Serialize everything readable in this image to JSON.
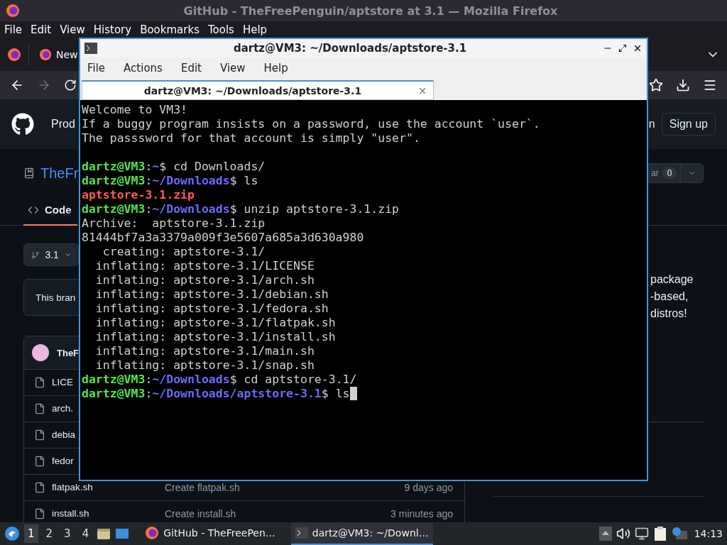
{
  "browser": {
    "title": "GitHub - TheFreePenguin/aptstore at 3.1 — Mozilla Firefox",
    "menu": [
      "File",
      "Edit",
      "View",
      "History",
      "Bookmarks",
      "Tools",
      "Help"
    ],
    "tab": {
      "label": "New"
    },
    "nav": {
      "forward_disabled": true
    },
    "page": {
      "header": {
        "nav_fragment": "Prod",
        "signin_fragment": "n",
        "signup": "Sign up"
      },
      "repo": {
        "name_fragment": "TheFr",
        "star_fragment": "ar",
        "star_count": "0"
      },
      "tabs": [
        {
          "label": "Code",
          "selected": true
        }
      ],
      "branch": "3.1",
      "notice_fragment": "This bran",
      "files_header": {
        "author_fragment": "TheF"
      },
      "files": [
        {
          "name": "LICE"
        },
        {
          "name": "arch."
        },
        {
          "name": "debia"
        },
        {
          "name": "fedor"
        },
        {
          "name": "flatpak.sh",
          "message": "Create flatpak.sh",
          "date": "9 days ago"
        },
        {
          "name": "install.sh",
          "message": "Create install.sh",
          "date": "3 minutes ago"
        }
      ],
      "about_fragments": [
        "package",
        "-based,",
        "distros!"
      ]
    }
  },
  "terminal": {
    "title": "dartz@VM3: ~/Downloads/aptstore-3.1",
    "menu": [
      "File",
      "Actions",
      "Edit",
      "View",
      "Help"
    ],
    "tab": {
      "label": "dartz@VM3: ~/Downloads/aptstore-3.1"
    },
    "lines": [
      {
        "kind": "text",
        "segments": [
          {
            "kind": "plain",
            "text": "Welcome to VM3!"
          }
        ]
      },
      {
        "kind": "text",
        "segments": [
          {
            "kind": "plain",
            "text": "If a buggy program insists on a password, use the account `user`."
          }
        ]
      },
      {
        "kind": "text",
        "segments": [
          {
            "kind": "plain",
            "text": "The passsword for that account is simply \"user\"."
          }
        ]
      },
      {
        "kind": "blank"
      },
      {
        "kind": "text",
        "segments": [
          {
            "kind": "user",
            "text": "dartz@VM3"
          },
          {
            "kind": "plain",
            "text": ":"
          },
          {
            "kind": "path",
            "text": "~"
          },
          {
            "kind": "plain",
            "text": "$ cd Downloads/"
          }
        ]
      },
      {
        "kind": "text",
        "segments": [
          {
            "kind": "user",
            "text": "dartz@VM3"
          },
          {
            "kind": "plain",
            "text": ":"
          },
          {
            "kind": "path",
            "text": "~/Downloads"
          },
          {
            "kind": "plain",
            "text": "$ ls"
          }
        ]
      },
      {
        "kind": "text",
        "segments": [
          {
            "kind": "file",
            "text": "aptstore-3.1.zip"
          }
        ]
      },
      {
        "kind": "text",
        "segments": [
          {
            "kind": "user",
            "text": "dartz@VM3"
          },
          {
            "kind": "plain",
            "text": ":"
          },
          {
            "kind": "path",
            "text": "~/Downloads"
          },
          {
            "kind": "plain",
            "text": "$ unzip aptstore-3.1.zip"
          }
        ]
      },
      {
        "kind": "text",
        "segments": [
          {
            "kind": "plain",
            "text": "Archive:  aptstore-3.1.zip"
          }
        ]
      },
      {
        "kind": "text",
        "segments": [
          {
            "kind": "plain",
            "text": "81444bf7a3a3379a009f3e5607a685a3d630a980"
          }
        ]
      },
      {
        "kind": "text",
        "segments": [
          {
            "kind": "plain",
            "text": "   creating: aptstore-3.1/"
          }
        ]
      },
      {
        "kind": "text",
        "segments": [
          {
            "kind": "plain",
            "text": "  inflating: aptstore-3.1/LICENSE"
          }
        ]
      },
      {
        "kind": "text",
        "segments": [
          {
            "kind": "plain",
            "text": "  inflating: aptstore-3.1/arch.sh"
          }
        ]
      },
      {
        "kind": "text",
        "segments": [
          {
            "kind": "plain",
            "text": "  inflating: aptstore-3.1/debian.sh"
          }
        ]
      },
      {
        "kind": "text",
        "segments": [
          {
            "kind": "plain",
            "text": "  inflating: aptstore-3.1/fedora.sh"
          }
        ]
      },
      {
        "kind": "text",
        "segments": [
          {
            "kind": "plain",
            "text": "  inflating: aptstore-3.1/flatpak.sh"
          }
        ]
      },
      {
        "kind": "text",
        "segments": [
          {
            "kind": "plain",
            "text": "  inflating: aptstore-3.1/install.sh"
          }
        ]
      },
      {
        "kind": "text",
        "segments": [
          {
            "kind": "plain",
            "text": "  inflating: aptstore-3.1/main.sh"
          }
        ]
      },
      {
        "kind": "text",
        "segments": [
          {
            "kind": "plain",
            "text": "  inflating: aptstore-3.1/snap.sh"
          }
        ]
      },
      {
        "kind": "text",
        "segments": [
          {
            "kind": "user",
            "text": "dartz@VM3"
          },
          {
            "kind": "plain",
            "text": ":"
          },
          {
            "kind": "path",
            "text": "~/Downloads"
          },
          {
            "kind": "plain",
            "text": "$ cd aptstore-3.1/"
          }
        ]
      },
      {
        "kind": "text",
        "cursor": true,
        "segments": [
          {
            "kind": "user",
            "text": "dartz@VM3"
          },
          {
            "kind": "plain",
            "text": ":"
          },
          {
            "kind": "path",
            "text": "~/Downloads/aptstore-3.1"
          },
          {
            "kind": "plain",
            "text": "$ ls"
          }
        ]
      }
    ]
  },
  "taskbar": {
    "workspaces": [
      {
        "label": "1",
        "selected": true
      },
      {
        "label": "2",
        "selected": false
      },
      {
        "label": "3",
        "selected": false
      },
      {
        "label": "4",
        "selected": false
      }
    ],
    "tasks": [
      {
        "kind": "browser",
        "label": "GitHub - TheFreePen…",
        "selected": false
      },
      {
        "kind": "terminal",
        "label": "dartz@VM3: ~/Downl…",
        "selected": true
      }
    ],
    "clock": "14:13"
  }
}
